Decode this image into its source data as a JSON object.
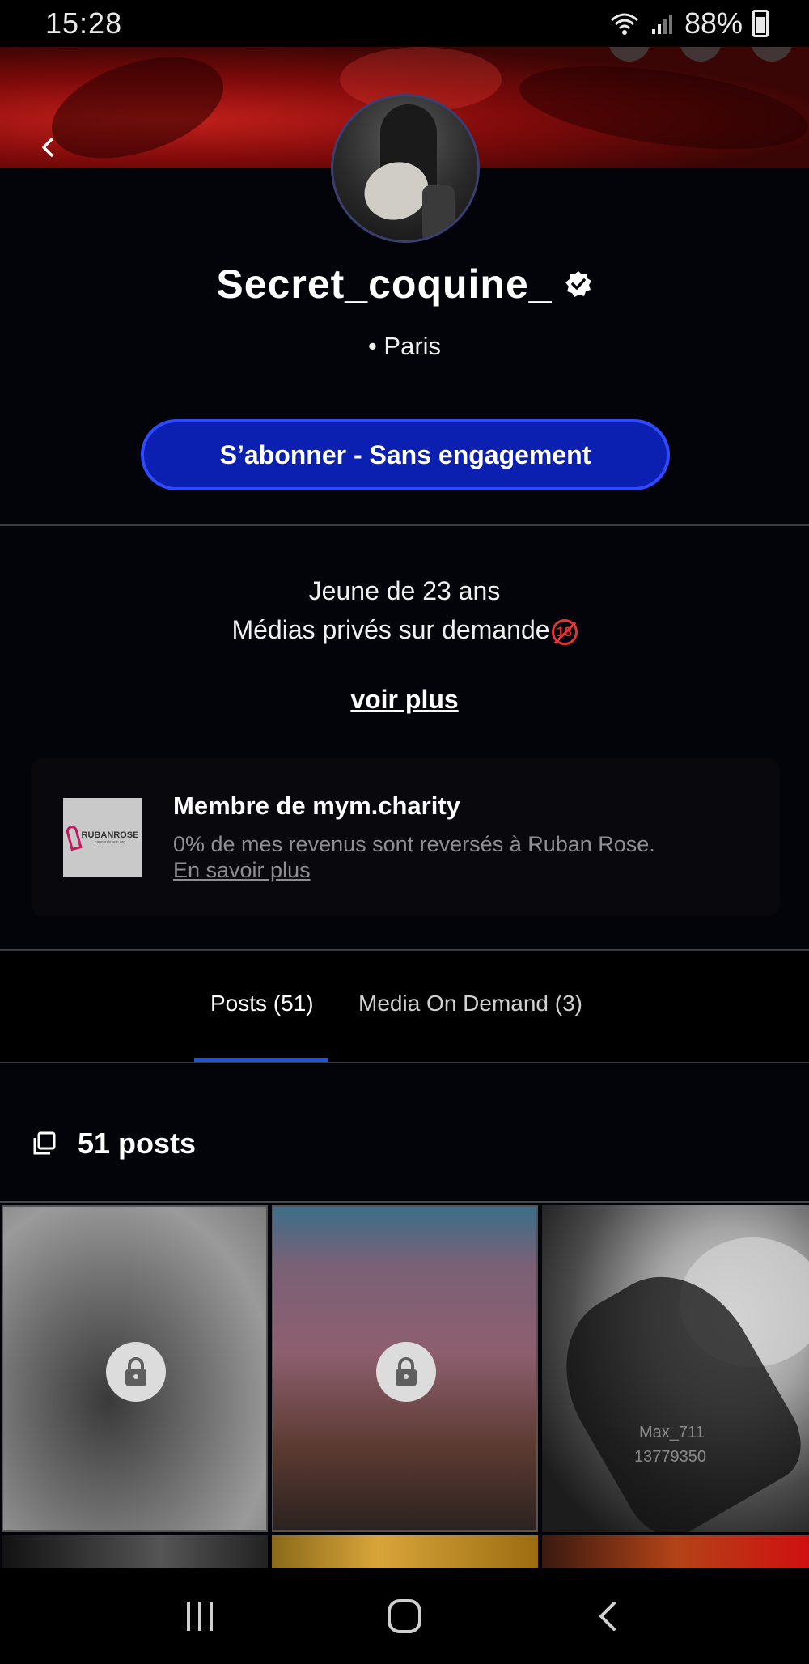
{
  "status_bar": {
    "time": "15:28",
    "battery": "88%"
  },
  "profile": {
    "name": "Secret_coquine_",
    "location": "• Paris",
    "subscribe_label": "S’abonner - Sans engagement"
  },
  "bio": {
    "line1": "Jeune de 23 ans",
    "line2": "Médias privés sur demande",
    "emoji_badge": "18",
    "more_label": "voir plus"
  },
  "charity": {
    "logo_text": "RUBANROSE",
    "logo_sub": "cancerdusein.org",
    "title": "Membre de mym.charity",
    "text": "0% de mes revenus sont reversés à Ruban Rose.",
    "link": "En savoir plus"
  },
  "tabs": [
    {
      "label": "Posts (51)",
      "active": true
    },
    {
      "label": "Media On Demand (3)",
      "active": false
    }
  ],
  "posts": {
    "count_label": "51 posts",
    "watermark_user": "Max_711",
    "watermark_id": "13779350"
  },
  "colors": {
    "accent": "#0b1fb0",
    "accent_border": "#2e49ff",
    "tab_indicator": "#1f55d6",
    "background": "#03030a"
  },
  "icons": {
    "back": "chevron-left-icon",
    "verified": "verified-badge-icon",
    "posts": "copy-icon",
    "lock": "lock-icon",
    "nav_recent": "recent-apps-icon",
    "nav_home": "home-icon",
    "nav_back": "back-icon"
  }
}
